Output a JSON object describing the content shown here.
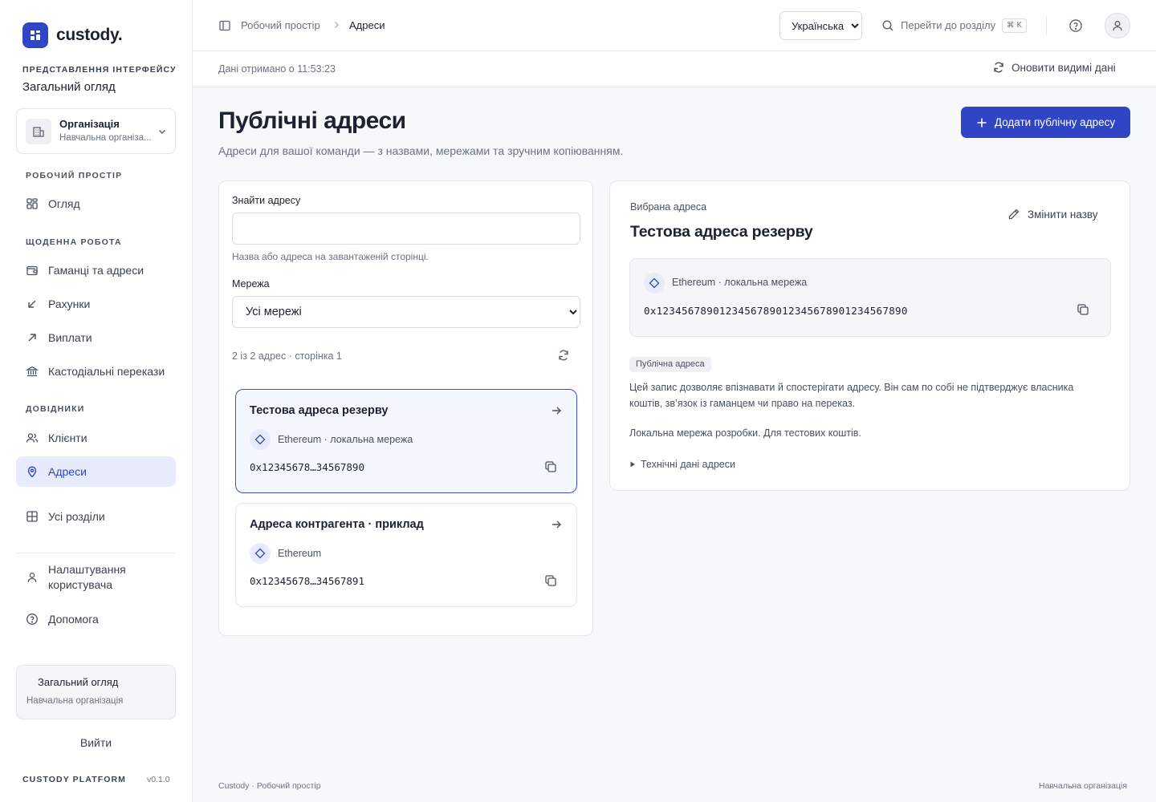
{
  "brand": {
    "name": "custody.",
    "accent": "#2f45c4"
  },
  "sidebar": {
    "view_label": "ПРЕДСТАВЛЕННЯ ІНТЕРФЕЙСУ",
    "view_value": "Загальний огляд",
    "org": {
      "title": "Організація",
      "subtitle": "Навчальна організа..."
    },
    "sections": [
      {
        "label": "РОБОЧИЙ ПРОСТІР"
      },
      {
        "label": "ЩОДЕННА РОБОТА"
      },
      {
        "label": "ДОВІДНИКИ"
      }
    ],
    "items": [
      {
        "label": "Огляд",
        "icon": "grid-icon"
      },
      {
        "label": "Гаманці та адреси",
        "icon": "wallet-icon"
      },
      {
        "label": "Рахунки",
        "icon": "arrow-down-left-icon"
      },
      {
        "label": "Виплати",
        "icon": "arrow-up-right-icon"
      },
      {
        "label": "Кастодіальні перекази",
        "icon": "bank-icon"
      },
      {
        "label": "Клієнти",
        "icon": "users-icon"
      },
      {
        "label": "Адреси",
        "icon": "map-pin-icon",
        "active": true
      },
      {
        "label": "Усі розділи",
        "icon": "table-icon"
      },
      {
        "label": "Налаштування користувача",
        "icon": "user-icon"
      },
      {
        "label": "Допомога",
        "icon": "help-circle-icon"
      }
    ],
    "profile": {
      "name": "Загальний огляд",
      "org": "Навчальна організація"
    },
    "logout": "Вийти",
    "platform": "CUSTODY PLATFORM",
    "version": "v0.1.0"
  },
  "topbar": {
    "breadcrumb": [
      "Робочий простір",
      "Адреси"
    ],
    "language": {
      "selected": "Українська"
    },
    "search_placeholder": "Перейти до розділу",
    "shortcut": "⌘ K"
  },
  "subbar": {
    "fetched": "Дані отримано о 11:53:23",
    "refresh_label": "Оновити видимі дані"
  },
  "page": {
    "title": "Публічні адреси",
    "subtitle": "Адреси для вашої команди — з назвами, мережами та зручним копіюванням.",
    "add_button": "Додати публічну адресу"
  },
  "filters": {
    "search_label": "Знайти адресу",
    "search_value": "",
    "search_help": "Назва або адреса на завантаженій сторінці.",
    "network_label": "Мережа",
    "network_selected": "Усі мережі",
    "count": "2 із 2 адрес · сторінка 1"
  },
  "addresses": [
    {
      "title": "Тестова адреса резерву",
      "network": "Ethereum · локальна мережа",
      "address": "0x12345678…34567890",
      "selected": true
    },
    {
      "title": "Адреса контрагента · приклад",
      "network": "Ethereum",
      "address": "0x12345678…34567891",
      "selected": false
    }
  ],
  "detail": {
    "label": "Вибрана адреса",
    "title": "Тестова адреса резерву",
    "rename": "Змінити назву",
    "network": "Ethereum · локальна мережа",
    "address": "0x1234567890123456789012345678901234567890",
    "badge": "Публічна адреса",
    "description": "Цей запис дозволяє впізнавати й спостерігати адресу. Він сам по собі не підтверджує власника коштів, зв’язок із гаманцем чи право на переказ.",
    "network_note": "Локальна мережа розробки. Для тестових коштів.",
    "technical": "Технічні дані адреси"
  },
  "footer": {
    "left": "Custody · Робочий простір",
    "right": "Навчальна організація"
  }
}
